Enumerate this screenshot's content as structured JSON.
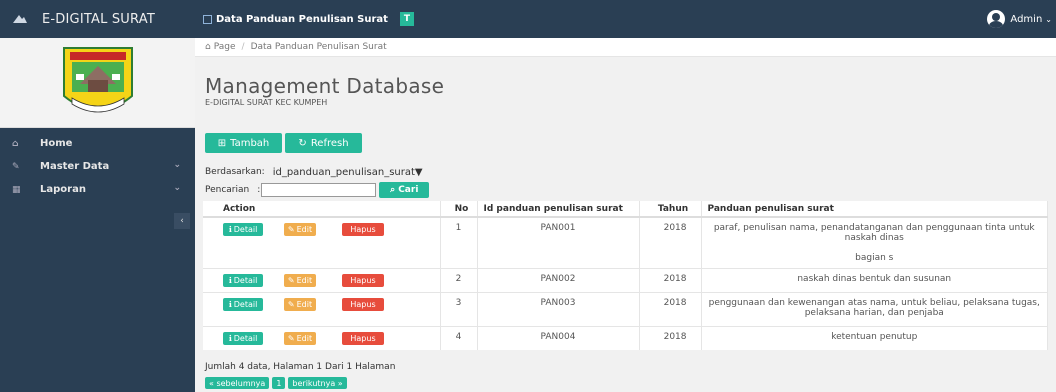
{
  "app": {
    "brand": "E-DIGITAL SURAT"
  },
  "topnav": {
    "title": "Data Panduan Penulisan Surat",
    "badge": "T",
    "user": "Admin"
  },
  "sidebar": {
    "items": [
      {
        "label": "Home",
        "icon": "home-icon"
      },
      {
        "label": "Master Data",
        "icon": "edit-icon",
        "chevron": "⌄"
      },
      {
        "label": "Laporan",
        "icon": "calendar-icon",
        "chevron": "⌄"
      }
    ],
    "collapse": "‹"
  },
  "breadcrumb": {
    "root": "Page",
    "current": "Data Panduan Penulisan Surat"
  },
  "heading": {
    "title": "Management Database",
    "subtitle": "E-DIGITAL SURAT KEC KUMPEH"
  },
  "toolbar": {
    "add_label": "Tambah",
    "refresh_label": "Refresh"
  },
  "filter": {
    "label": "Berdasarkan:",
    "selected": "id_panduan_penulisan_surat"
  },
  "search": {
    "label": "Pencarian",
    "placeholder": "",
    "button": "Cari"
  },
  "table": {
    "headers": [
      "Action",
      "No",
      "Id panduan penulisan surat",
      "Tahun",
      "Panduan penulisan surat"
    ],
    "action_labels": {
      "detail": "Detail",
      "edit": "Edit",
      "hapus": "Hapus"
    },
    "rows": [
      {
        "no": "1",
        "id": "PAN001",
        "tahun": "2018",
        "panduan": "paraf, penulisan nama, penandatanganan dan penggunaan tinta untuk naskah dinas",
        "panduan_extra": "bagian s"
      },
      {
        "no": "2",
        "id": "PAN002",
        "tahun": "2018",
        "panduan": "naskah dinas bentuk dan susunan",
        "panduan_extra": ""
      },
      {
        "no": "3",
        "id": "PAN003",
        "tahun": "2018",
        "panduan": "penggunaan dan kewenangan atas nama, untuk beliau, pelaksana tugas, pelaksana harian, dan penjaba",
        "panduan_extra": ""
      },
      {
        "no": "4",
        "id": "PAN004",
        "tahun": "2018",
        "panduan": "ketentuan penutup",
        "panduan_extra": ""
      }
    ]
  },
  "footer": {
    "info": "Jumlah 4 data, Halaman 1 Dari 1 Halaman",
    "prev": "« sebelumnya",
    "page": "1",
    "next": "berikutnya »"
  },
  "colors": {
    "sidebar": "#2a3f54",
    "green": "#26b99a",
    "orange": "#f0ad4e",
    "red": "#e74c3c"
  }
}
